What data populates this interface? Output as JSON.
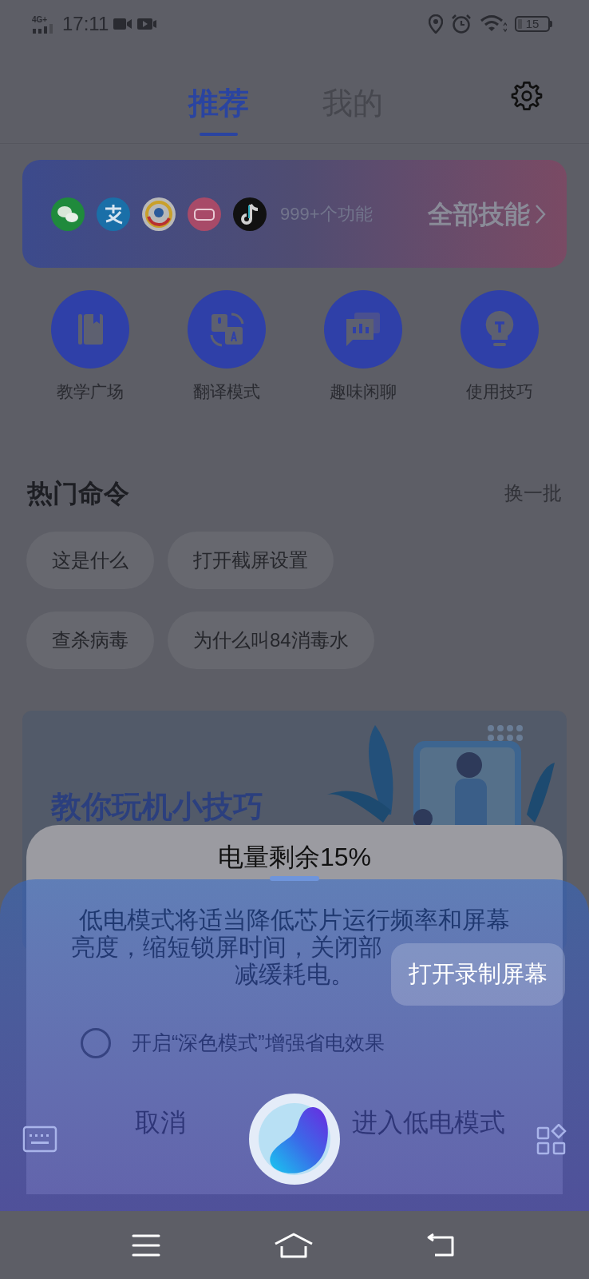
{
  "status_bar": {
    "network": "4G+",
    "time": "17:11",
    "battery": "15"
  },
  "tabs": [
    {
      "label": "推荐",
      "selected": true
    },
    {
      "label": "我的",
      "selected": false
    }
  ],
  "skills_banner": {
    "count": "999+个功能",
    "link": "全部技能"
  },
  "features": [
    {
      "label": "教学广场"
    },
    {
      "label": "翻译模式"
    },
    {
      "label": "趣味闲聊"
    },
    {
      "label": "使用技巧"
    }
  ],
  "hot_commands": {
    "title": "热门命令",
    "refresh": "换一批",
    "chips": [
      "这是什么",
      "打开截屏设置",
      "查杀病毒",
      "为什么叫84消毒水"
    ]
  },
  "tips_card": {
    "title": "教你玩机小技巧"
  },
  "dialog": {
    "title": "电量剩余15%",
    "message_lines": [
      "低电模式将适当降低芯片运行频率和屏幕",
      "亮度，缩短锁屏时间，关闭部",
      "减缓耗电。"
    ],
    "option": {
      "label": "开启“深色模式”增强省电效果",
      "checked": false
    },
    "buttons": [
      "取消",
      "进入低电模式"
    ]
  },
  "assistant": {
    "suggestion": "打开录制屏幕"
  }
}
